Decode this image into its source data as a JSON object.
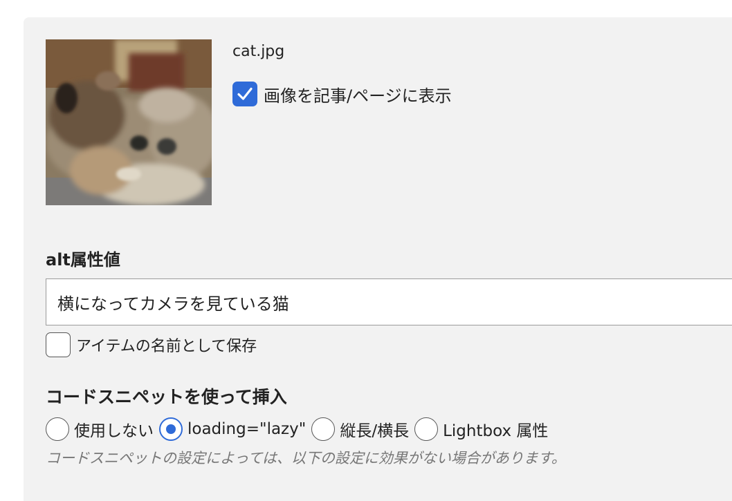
{
  "image": {
    "filename": "cat.jpg",
    "thumbnail_icon": "cat-photo-thumbnail",
    "show_in_post": {
      "label": "画像を記事/ページに表示",
      "checked": true
    }
  },
  "alt": {
    "heading": "alt属性値",
    "value": "横になってカメラを見ている猫",
    "save_as_name": {
      "label": "アイテムの名前として保存",
      "checked": false
    }
  },
  "snippet": {
    "heading": "コードスニペットを使って挿入",
    "options": [
      {
        "label": "使用しない",
        "selected": false
      },
      {
        "label": "loading=\"lazy\"",
        "selected": true
      },
      {
        "label": "縦長/横長",
        "selected": false
      },
      {
        "label": "Lightbox 属性",
        "selected": false
      }
    ],
    "note": "コードスニペットの設定によっては、以下の設定に効果がない場合があります。"
  },
  "colors": {
    "accent": "#2f6bd8",
    "panel_background": "#f2f2f2",
    "note_text": "#777777"
  }
}
